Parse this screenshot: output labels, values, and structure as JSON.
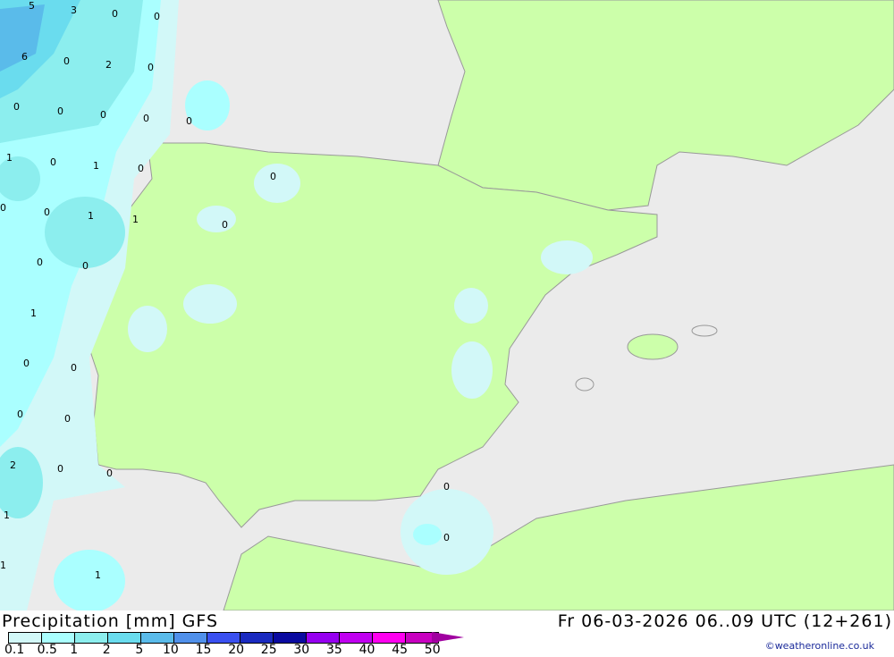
{
  "title": "Precipitation [mm] GFS",
  "datetime": "Fr 06-03-2026 06..09 UTC (12+261)",
  "credit": "©weatheronline.co.uk",
  "colors": {
    "sea": "#ebebeb",
    "land": "#ccffaa",
    "coast": "#999999"
  },
  "legend": {
    "ticks": [
      "0.1",
      "0.5",
      "1",
      "2",
      "5",
      "10",
      "15",
      "20",
      "25",
      "30",
      "35",
      "40",
      "45",
      "50"
    ],
    "swatches": [
      "#d2f8f8",
      "#aaffff",
      "#8ceeee",
      "#6adcee",
      "#5abbea",
      "#5090ea",
      "#3a50f0",
      "#1a2ac0",
      "#0a0aa0",
      "#9600f0",
      "#c000f0",
      "#ff00f0",
      "#c800c0"
    ]
  },
  "map_labels": [
    "5",
    "3",
    "0",
    "0",
    "6",
    "0",
    "2",
    "0",
    "0",
    "0",
    "0",
    "0",
    "0",
    "1",
    "0",
    "1",
    "0",
    "0",
    "0",
    "0",
    "1",
    "1",
    "0",
    "0",
    "0",
    "1",
    "0",
    "0",
    "0",
    "0",
    "2",
    "0",
    "0",
    "0",
    "1",
    "0",
    "1",
    "1"
  ]
}
